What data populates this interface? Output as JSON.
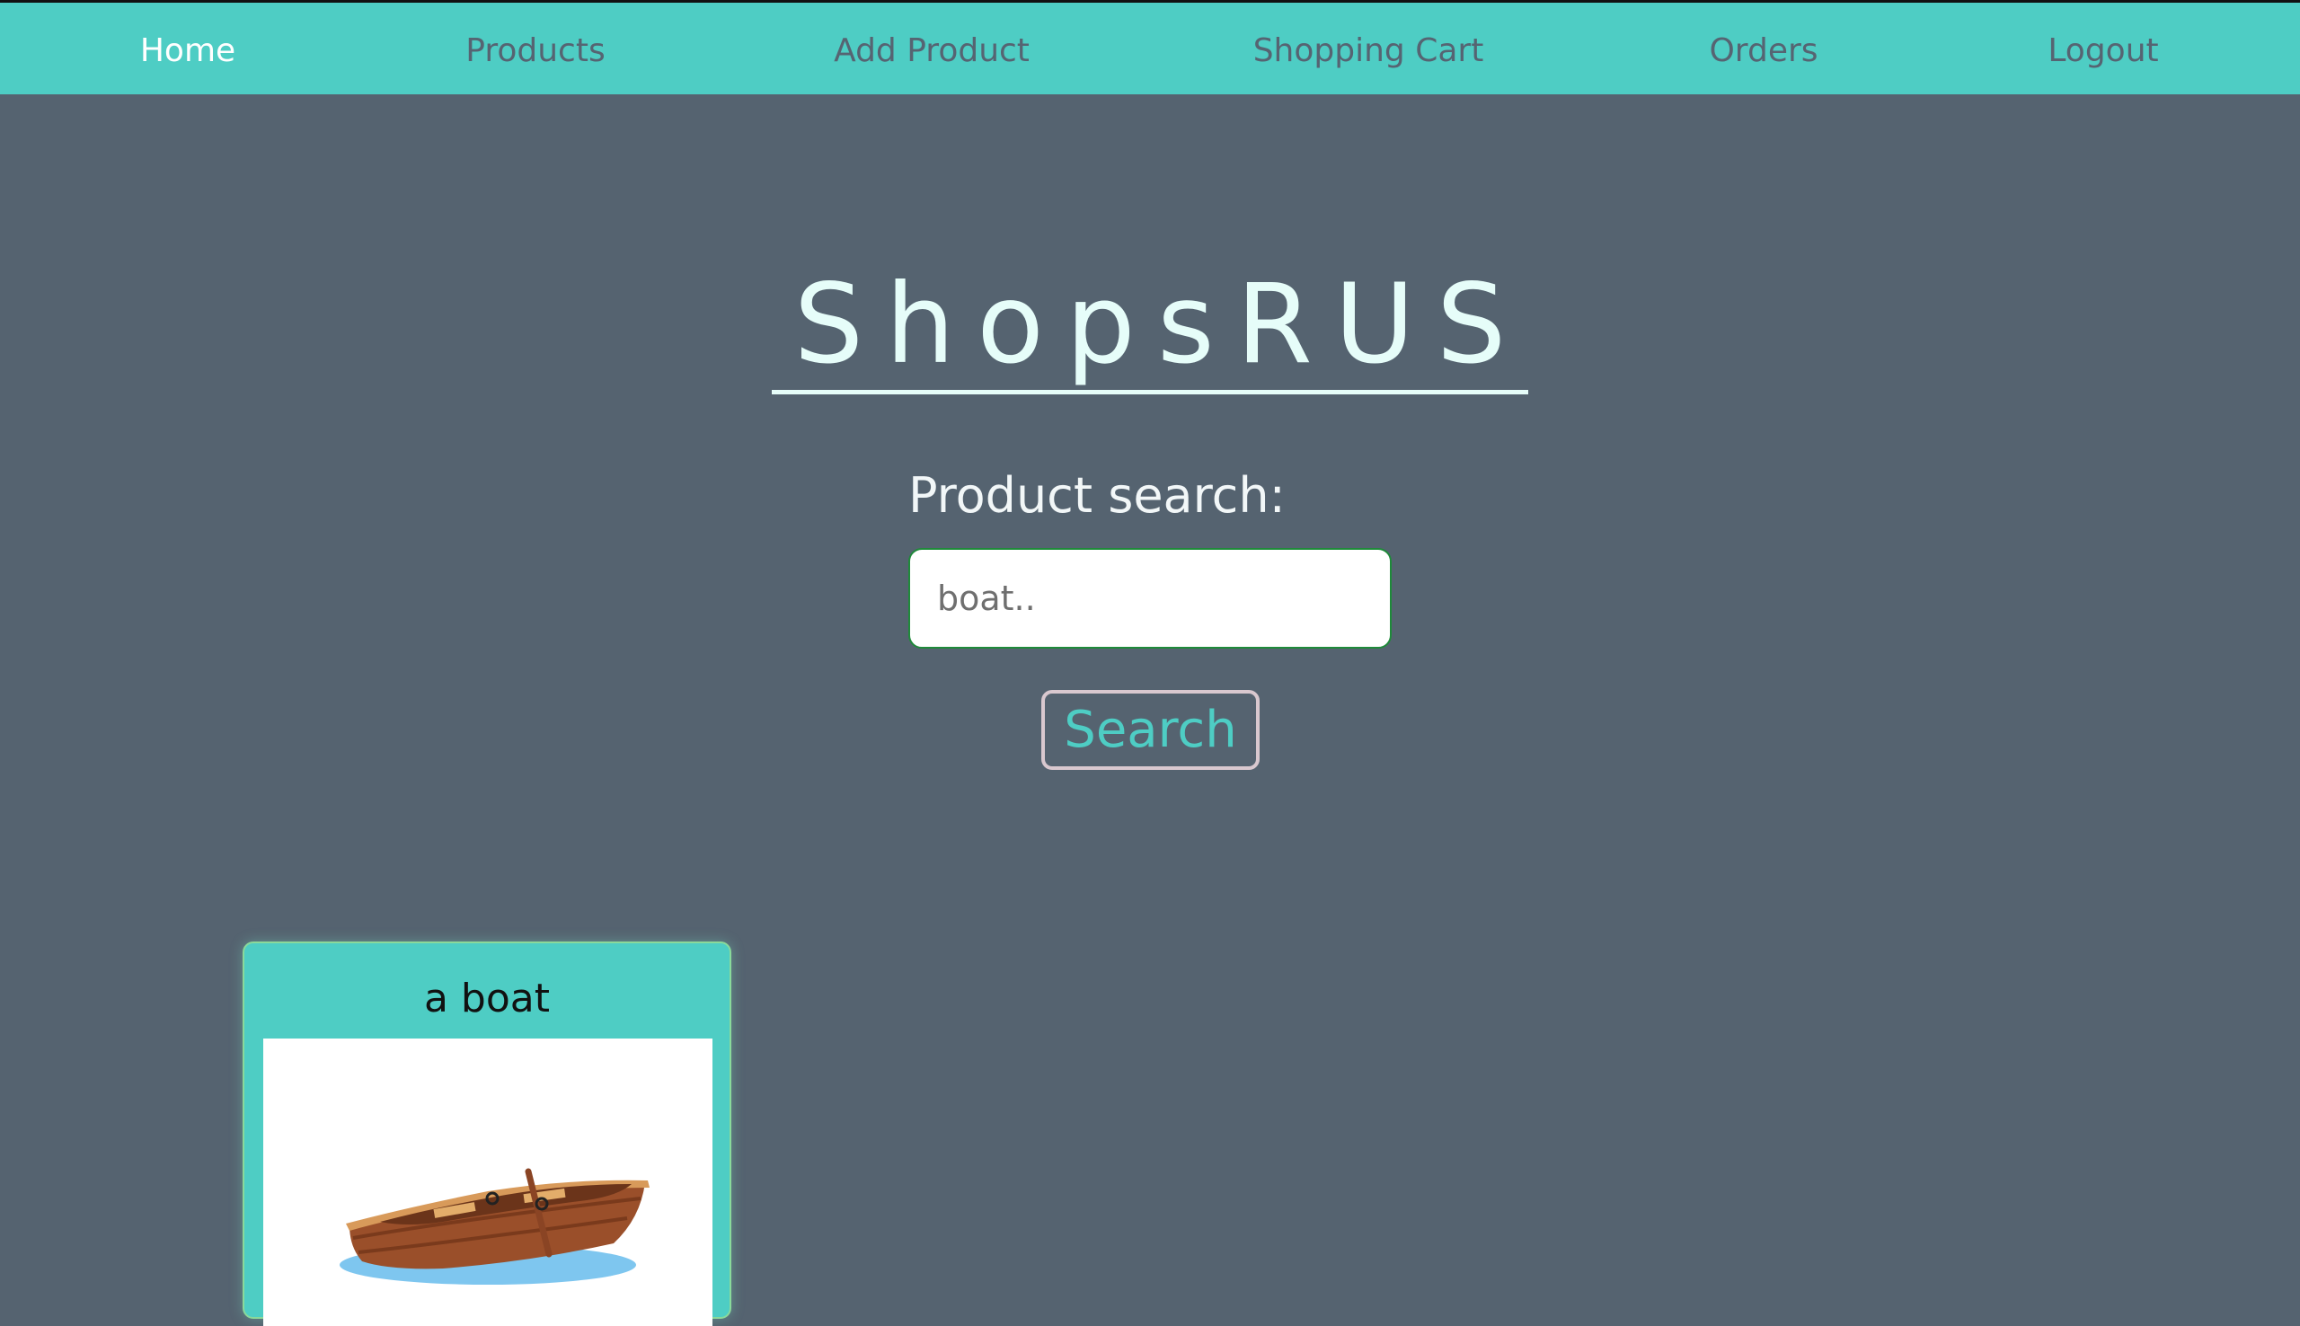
{
  "nav": {
    "items": [
      {
        "label": "Home",
        "active": true
      },
      {
        "label": "Products",
        "active": false
      },
      {
        "label": "Add Product",
        "active": false
      },
      {
        "label": "Shopping Cart",
        "active": false
      },
      {
        "label": "Orders",
        "active": false
      },
      {
        "label": "Logout",
        "active": false
      }
    ]
  },
  "header": {
    "title": "ShopsRUS"
  },
  "search": {
    "label": "Product search:",
    "placeholder": "boat..",
    "value": "",
    "button_label": "Search"
  },
  "results": [
    {
      "name": "a boat",
      "image_icon": "rowboat-image"
    }
  ],
  "colors": {
    "accent": "#4ecdc4",
    "background": "#556370",
    "nav_text": "#566472",
    "nav_text_active": "#ffffff",
    "title": "#e6fdf9"
  }
}
